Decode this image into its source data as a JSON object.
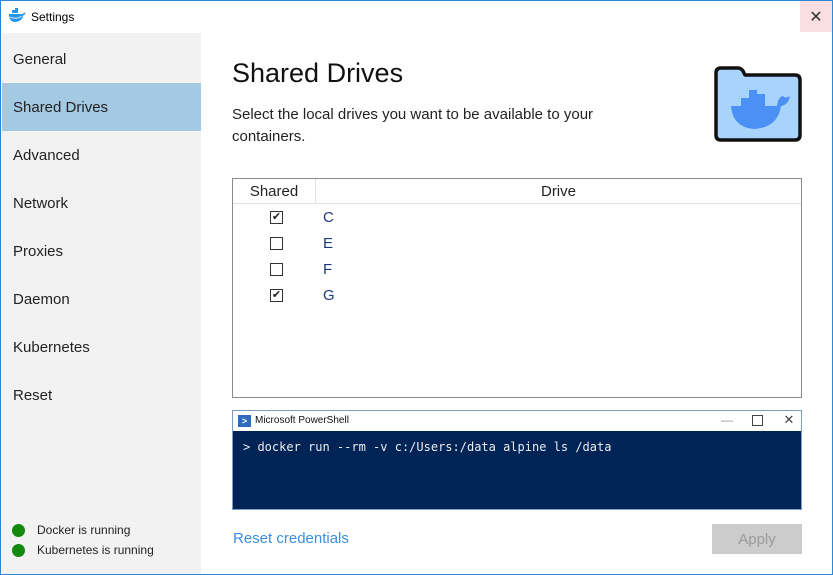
{
  "window": {
    "title": "Settings",
    "app_icon": "docker-whale-icon",
    "close_icon": "close-icon"
  },
  "sidebar": {
    "items": [
      {
        "label": "General",
        "active": false
      },
      {
        "label": "Shared Drives",
        "active": true
      },
      {
        "label": "Advanced",
        "active": false
      },
      {
        "label": "Network",
        "active": false
      },
      {
        "label": "Proxies",
        "active": false
      },
      {
        "label": "Daemon",
        "active": false
      },
      {
        "label": "Kubernetes",
        "active": false
      },
      {
        "label": "Reset",
        "active": false
      }
    ],
    "status": [
      {
        "label": "Docker is running",
        "color": "#138a0f"
      },
      {
        "label": "Kubernetes is running",
        "color": "#138a0f"
      }
    ]
  },
  "main": {
    "title": "Shared Drives",
    "description": "Select the local drives you want to be available to your containers.",
    "header_icon": "docker-folder-icon",
    "table": {
      "columns": [
        "Shared",
        "Drive"
      ],
      "rows": [
        {
          "shared": true,
          "drive": "C"
        },
        {
          "shared": false,
          "drive": "E"
        },
        {
          "shared": false,
          "drive": "F"
        },
        {
          "shared": true,
          "drive": "G"
        }
      ]
    },
    "powershell": {
      "title": "Microsoft PowerShell",
      "command": "> docker run --rm -v c:/Users:/data alpine ls /data"
    },
    "reset_credentials": "Reset credentials",
    "apply": "Apply"
  },
  "colors": {
    "accent": "#2b88d8",
    "sidebar_active": "#a4c9e3",
    "link": "#3d8fe0",
    "powershell_bg": "#012456",
    "status_green": "#138a0f"
  }
}
